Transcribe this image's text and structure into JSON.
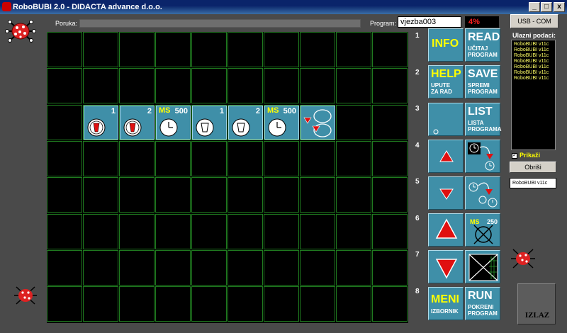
{
  "window": {
    "title": "RoboBUBI 2.0 - DIDACTA advance d.o.o.",
    "minimize": "_",
    "maximize": "□",
    "close": "x"
  },
  "header": {
    "message_label": "Poruka:",
    "program_label": "Program:",
    "program_value": "vjezba003",
    "progress": "4%",
    "usb_button": "USB - COM"
  },
  "grid": {
    "tiles": [
      {
        "col": 1,
        "kind": "reader",
        "num": "1",
        "ms": ""
      },
      {
        "col": 2,
        "kind": "reader",
        "num": "2",
        "ms": ""
      },
      {
        "col": 3,
        "kind": "clock",
        "num": "500",
        "ms": "MS"
      },
      {
        "col": 4,
        "kind": "cup",
        "num": "1",
        "ms": ""
      },
      {
        "col": 5,
        "kind": "cup",
        "num": "2",
        "ms": ""
      },
      {
        "col": 6,
        "kind": "clock",
        "num": "500",
        "ms": "MS"
      },
      {
        "col": 7,
        "kind": "loop",
        "num": "",
        "ms": ""
      }
    ]
  },
  "row_numbers": [
    "1",
    "2",
    "3",
    "4",
    "5",
    "6",
    "7",
    "8"
  ],
  "buttons": {
    "info": "INFO",
    "help": "HELP",
    "help_sub1": "UPUTE",
    "help_sub2": "ZA RAD",
    "read": "READ",
    "read_sub1": "UČITAJ",
    "read_sub2": "PROGRAM",
    "save": "SAVE",
    "save_sub1": "SPREMI",
    "save_sub2": "PROGRAM",
    "list": "LIST",
    "list_sub1": "LISTA",
    "list_sub2": "PROGRAMA",
    "meni": "MENI",
    "meni_sub": "IZBORNIK",
    "run": "RUN",
    "run_sub1": "POKRENI",
    "run_sub2": "PROGRAM",
    "ms_label": "MS",
    "ms_value": "250"
  },
  "side": {
    "inputs_title": "Ulazni podaci:",
    "inputs": [
      "RoboBUBI v11c",
      "RoboBUBI v11c",
      "RoboBUBI v11c",
      "RoboBUBI v11c",
      "RoboBUBI v11c",
      "RoboBUBI v11c",
      "RoboBUBI v11c"
    ],
    "show_label": "Prikaži",
    "clear_button": "Obriši",
    "device_value": "RoboBUBI v11c",
    "exit_label": "IZLAZ"
  },
  "colors": {
    "tile": "#3f8fa8",
    "grid_line": "#1f7a1f",
    "accent_yellow": "#ffff00",
    "red": "#e01010"
  }
}
